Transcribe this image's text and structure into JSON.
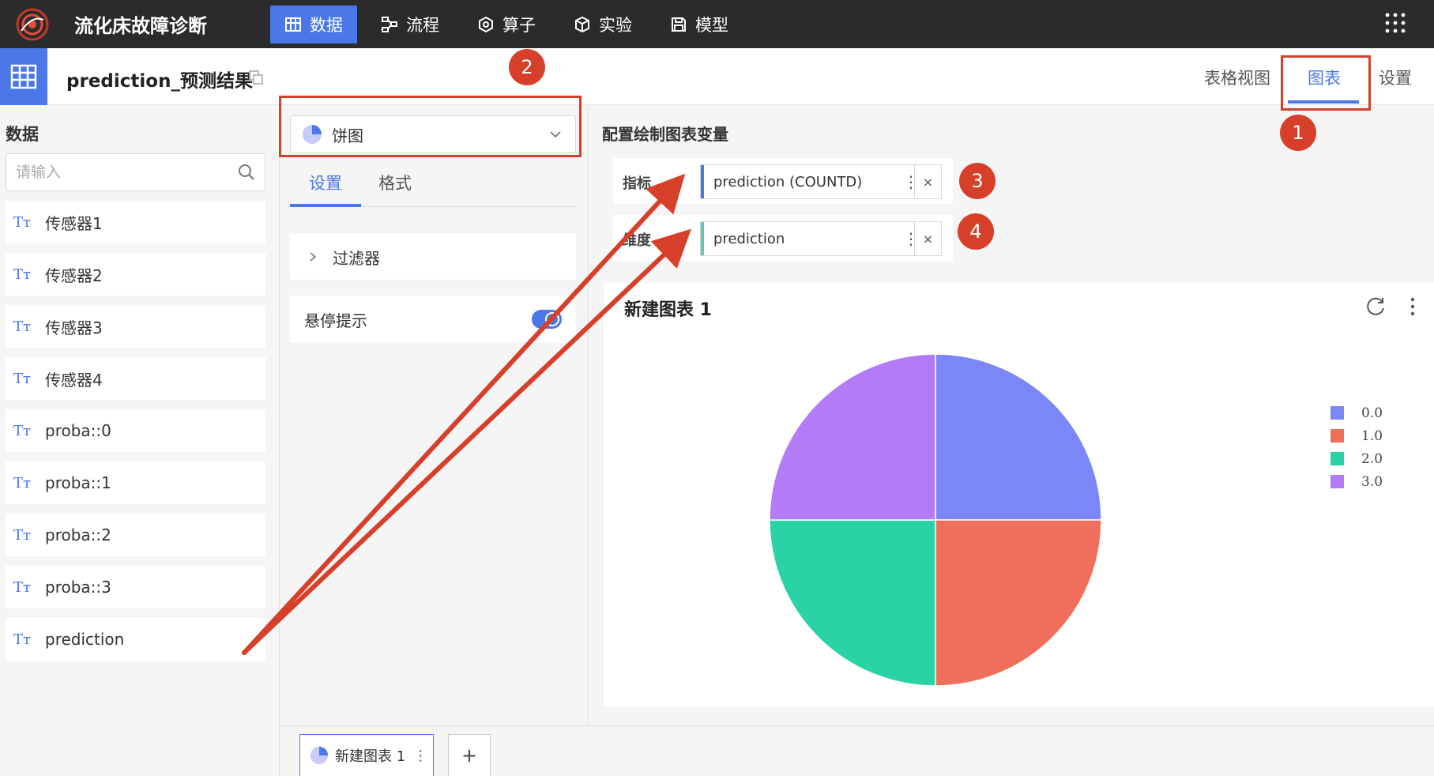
{
  "app": {
    "title": "流化床故障诊断"
  },
  "nav": [
    {
      "label": "数据",
      "icon": "grid-icon",
      "active": true
    },
    {
      "label": "流程",
      "icon": "flow-icon",
      "active": false
    },
    {
      "label": "算子",
      "icon": "operator-icon",
      "active": false
    },
    {
      "label": "实验",
      "icon": "cube-icon",
      "active": false
    },
    {
      "label": "模型",
      "icon": "save-icon",
      "active": false
    }
  ],
  "header": {
    "title": "prediction_预测结果",
    "tabs": [
      {
        "label": "表格视图",
        "active": false
      },
      {
        "label": "图表",
        "active": true
      },
      {
        "label": "设置",
        "active": false
      }
    ]
  },
  "left": {
    "label": "数据",
    "search_placeholder": "请输入",
    "field_type_glyph": "Tт",
    "fields": [
      "传感器1",
      "传感器2",
      "传感器3",
      "传感器4",
      "proba::0",
      "proba::1",
      "proba::2",
      "proba::3",
      "prediction"
    ]
  },
  "middle": {
    "chart_type": "饼图",
    "tabs": [
      {
        "label": "设置",
        "active": true
      },
      {
        "label": "格式",
        "active": false
      }
    ],
    "filter_label": "过滤器",
    "tooltip_label": "悬停提示",
    "tooltip_enabled": true
  },
  "config": {
    "title": "配置绘制图表变量",
    "metric_label": "指标",
    "metric_value": "prediction (COUNTD)",
    "dimension_label": "维度",
    "dimension_value": "prediction",
    "menu_glyph": "⋮",
    "close_glyph": "×"
  },
  "chart_card": {
    "title": "新建图表 1"
  },
  "chart_data": {
    "type": "pie",
    "categories": [
      "0.0",
      "1.0",
      "2.0",
      "3.0"
    ],
    "values": [
      1,
      1,
      1,
      1
    ],
    "colors": [
      "#7b86f7",
      "#ef6f5c",
      "#2ad3a5",
      "#b47bf7"
    ],
    "legend_position": "right"
  },
  "bottom": {
    "tab_label": "新建图表 1",
    "menu_glyph": "⋮",
    "add_label": "+"
  },
  "annotations": [
    "1",
    "2",
    "3",
    "4"
  ],
  "colors": {
    "accent": "#4a78e8",
    "annotation": "#d6402b",
    "nav_bg": "#2b2b2b"
  }
}
